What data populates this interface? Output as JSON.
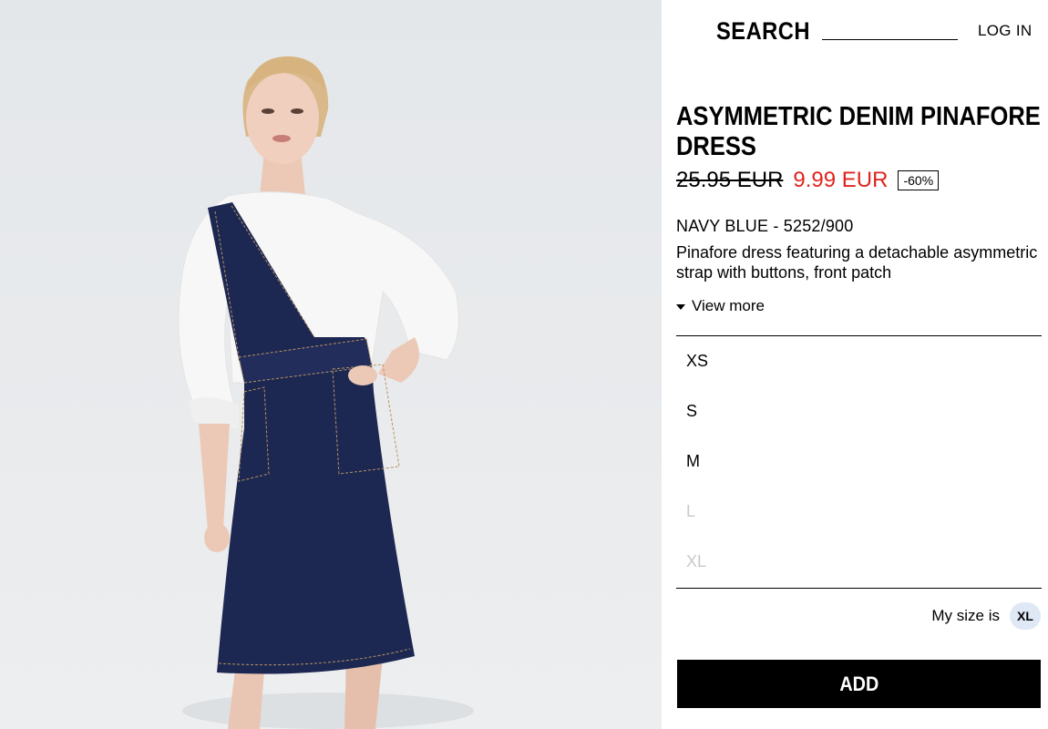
{
  "header": {
    "search_label": "SEARCH",
    "login_label": "LOG IN"
  },
  "product": {
    "title": "ASYMMETRIC DENIM PINAFORE DRESS",
    "old_price": "25.95 EUR",
    "new_price": "9.99 EUR",
    "discount": "-60%",
    "color_ref": "NAVY BLUE - 5252/900",
    "description": "Pinafore dress featuring a detachable asymmetric strap with buttons, front patch",
    "view_more_label": "View more",
    "image_alt": "product-photo"
  },
  "sizes": [
    {
      "label": "XS",
      "available": true
    },
    {
      "label": "S",
      "available": true
    },
    {
      "label": "M",
      "available": true
    },
    {
      "label": "L",
      "available": false
    },
    {
      "label": "XL",
      "available": false
    }
  ],
  "my_size": {
    "label": "My size is",
    "value": "XL"
  },
  "add_button_label": "ADD",
  "colors": {
    "sale_price": "#e0241e",
    "unavailable_size": "#c8c8c8",
    "size_badge_bg": "#dfe9f5",
    "denim": "#1c2752",
    "shirt": "#f7f7f7",
    "background": "#e6e9ec"
  }
}
